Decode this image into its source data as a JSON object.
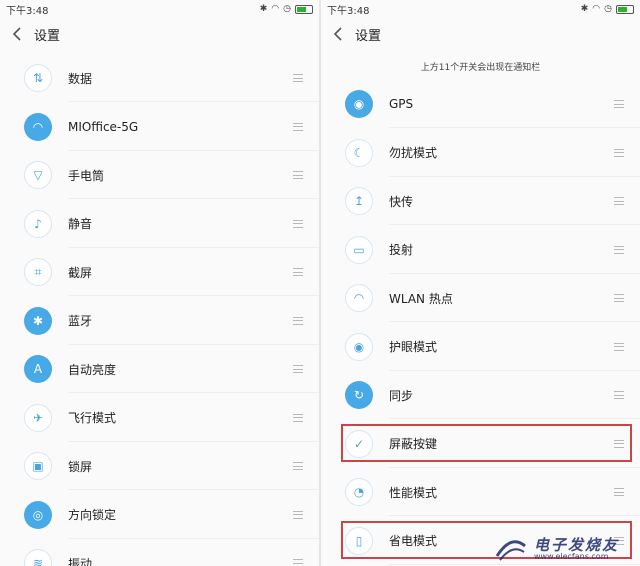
{
  "left": {
    "status": {
      "time": "下午3:48"
    },
    "title": "设置",
    "items": [
      {
        "label": "数据",
        "icon": "data-arrows-icon",
        "on": false
      },
      {
        "label": "MIOffice-5G",
        "icon": "wifi-icon",
        "on": true
      },
      {
        "label": "手电筒",
        "icon": "flashlight-icon",
        "on": false
      },
      {
        "label": "静音",
        "icon": "mute-bell-icon",
        "on": false
      },
      {
        "label": "截屏",
        "icon": "screenshot-icon",
        "on": false
      },
      {
        "label": "蓝牙",
        "icon": "bluetooth-icon",
        "on": true
      },
      {
        "label": "自动亮度",
        "icon": "auto-brightness-icon",
        "on": true
      },
      {
        "label": "飞行模式",
        "icon": "airplane-icon",
        "on": false
      },
      {
        "label": "锁屏",
        "icon": "lock-icon",
        "on": false
      },
      {
        "label": "方向锁定",
        "icon": "rotation-lock-icon",
        "on": true
      },
      {
        "label": "振动",
        "icon": "vibrate-icon",
        "on": false
      }
    ]
  },
  "right": {
    "status": {
      "time": "下午3:48"
    },
    "title": "设置",
    "hint": "上方11个开关会出现在通知栏",
    "items": [
      {
        "label": "GPS",
        "icon": "gps-icon",
        "on": true
      },
      {
        "label": "勿扰模式",
        "icon": "moon-icon",
        "on": false
      },
      {
        "label": "快传",
        "icon": "quick-transfer-icon",
        "on": false
      },
      {
        "label": "投射",
        "icon": "cast-icon",
        "on": false
      },
      {
        "label": "WLAN 热点",
        "icon": "hotspot-icon",
        "on": false
      },
      {
        "label": "护眼模式",
        "icon": "eye-icon",
        "on": false
      },
      {
        "label": "同步",
        "icon": "sync-icon",
        "on": true
      },
      {
        "label": "屏蔽按键",
        "icon": "block-keys-icon",
        "on": false,
        "highlighted": true
      },
      {
        "label": "性能模式",
        "icon": "performance-icon",
        "on": false
      },
      {
        "label": "省电模式",
        "icon": "battery-saver-icon",
        "on": false,
        "highlighted": true
      }
    ]
  },
  "watermark": {
    "brand": "电子发烧友",
    "url": "www.elecfans.com"
  },
  "colors": {
    "accent": "#47a9e6",
    "highlight": "#c8464a"
  }
}
